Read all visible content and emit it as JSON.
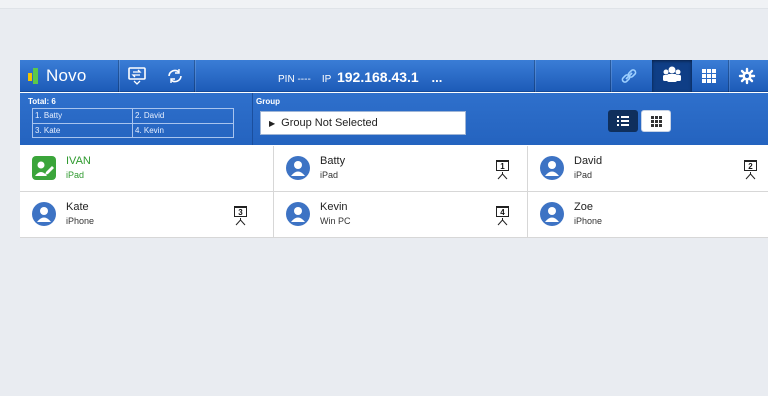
{
  "toolbar": {
    "app_name": "Novo",
    "pin_label": "PIN",
    "pin_value": "----",
    "ip_label": "IP",
    "ip_value": "192.168.43.1",
    "more": "...",
    "icons": [
      "screen-share-icon",
      "refresh-icon",
      "link-icon",
      "users-icon",
      "grid-icon",
      "gear-icon"
    ]
  },
  "info": {
    "total_label": "Total: 6",
    "presenters": [
      "1. Batty",
      "2. David",
      "3. Kate",
      "4. Kevin"
    ],
    "group_label": "Group",
    "group_value": "Group Not Selected"
  },
  "devices": [
    {
      "name": "IVAN",
      "type": "iPad",
      "avatar": "edit-user-icon",
      "highlight": true,
      "slot": ""
    },
    {
      "name": "Batty",
      "type": "iPad",
      "avatar": "user-icon",
      "highlight": false,
      "slot": "1"
    },
    {
      "name": "David",
      "type": "iPad",
      "avatar": "user-icon",
      "highlight": false,
      "slot": "2"
    },
    {
      "name": "Kate",
      "type": "iPhone",
      "avatar": "user-icon",
      "highlight": false,
      "slot": "3"
    },
    {
      "name": "Kevin",
      "type": "Win PC",
      "avatar": "user-icon",
      "highlight": false,
      "slot": "4"
    },
    {
      "name": "Zoe",
      "type": "iPhone",
      "avatar": "user-icon",
      "highlight": false,
      "slot": ""
    }
  ],
  "colors": {
    "toolbar": "#2a6bc8",
    "highlight": "#2f9a2f",
    "active_tab": "#0f3e86"
  }
}
